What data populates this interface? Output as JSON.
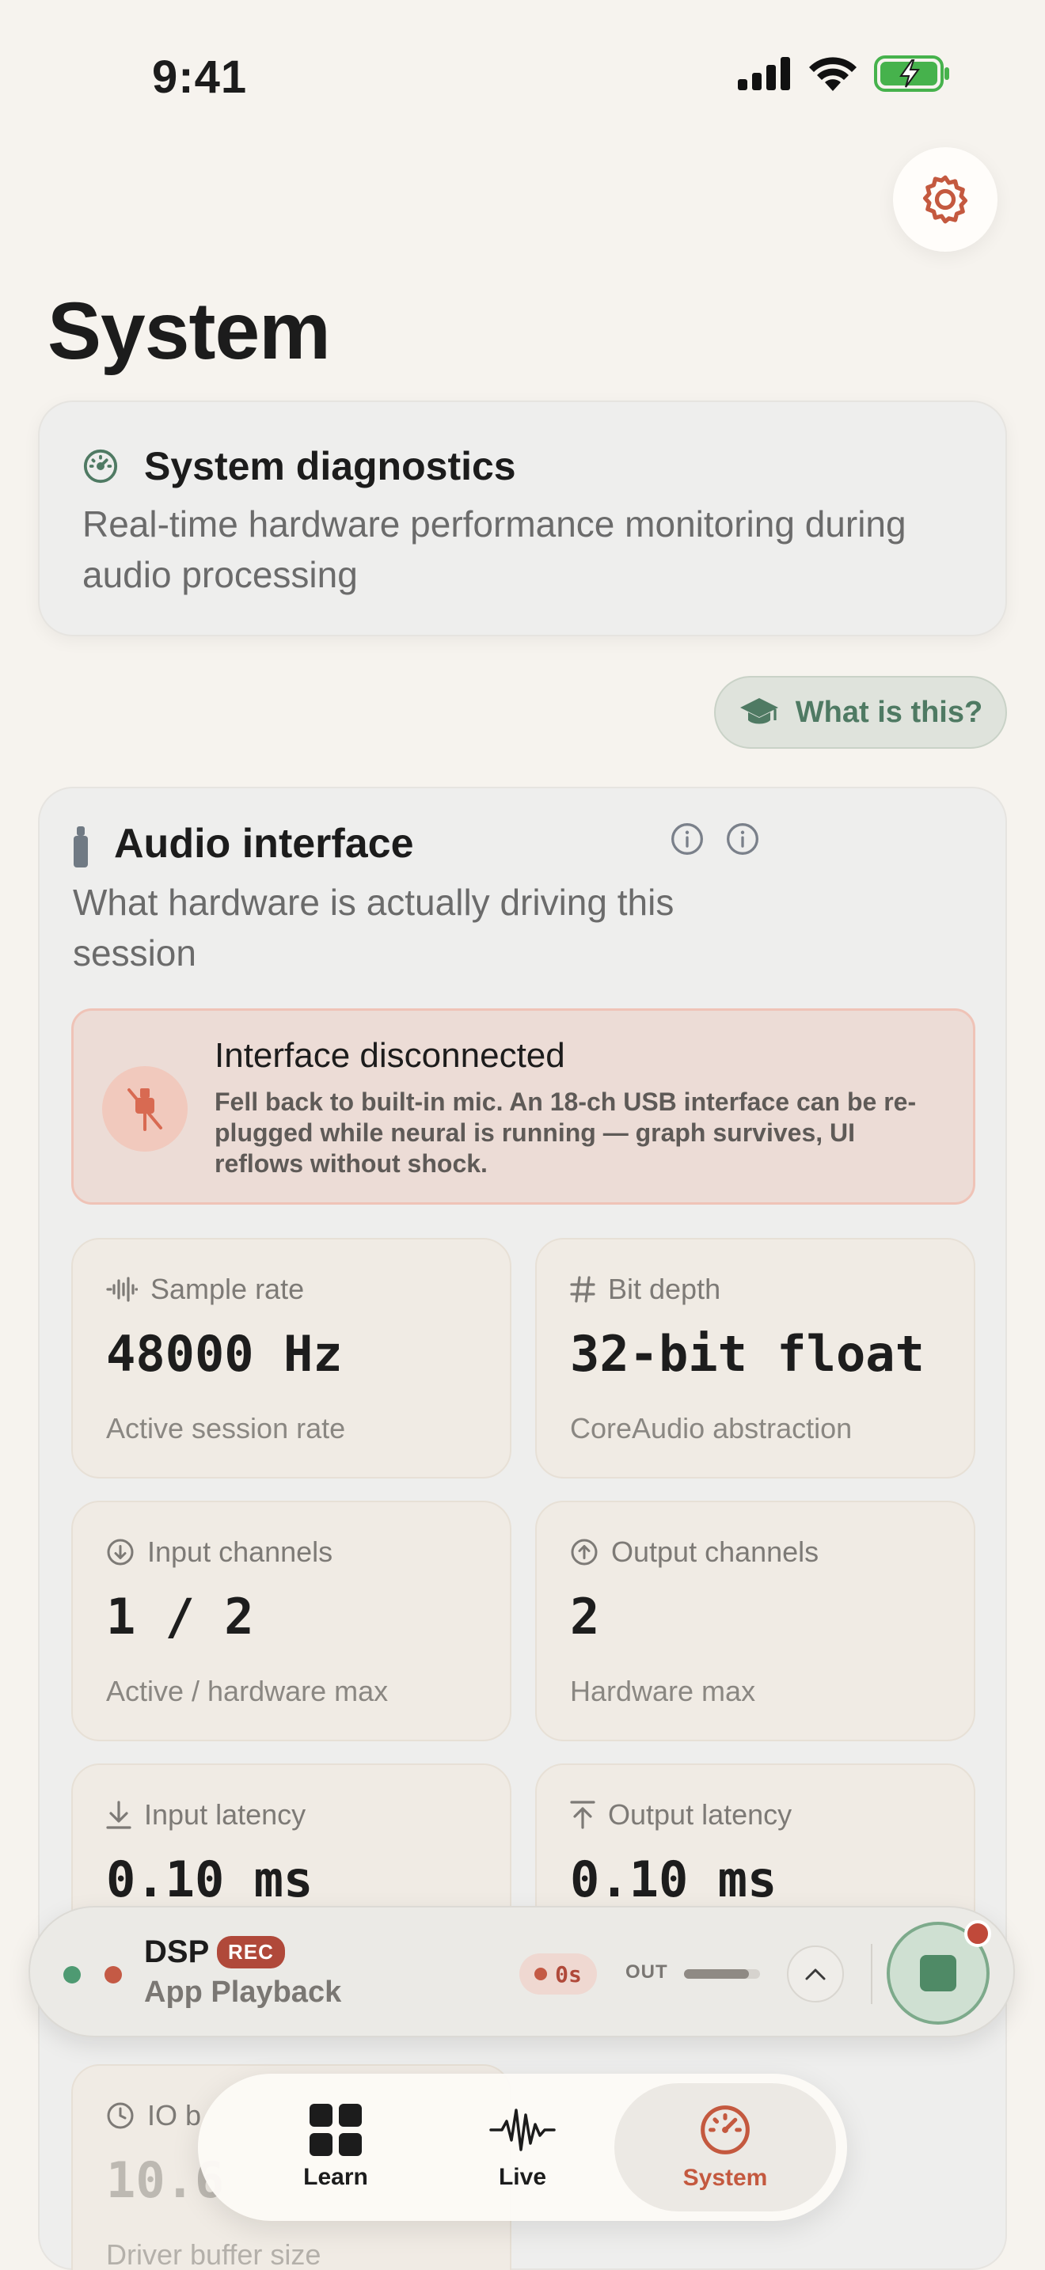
{
  "status_bar": {
    "time": "9:41"
  },
  "page": {
    "title": "System"
  },
  "diagnostics": {
    "title": "System diagnostics",
    "description": "Real-time hardware performance monitoring during audio processing"
  },
  "help_button": {
    "label": "What is this?"
  },
  "audio_interface": {
    "title": "Audio interface",
    "subtitle": "What hardware is actually driving this session",
    "alert": {
      "title": "Interface disconnected",
      "body": "Fell back to built-in mic. An 18-ch USB interface can be re-plugged while neural is running — graph survives, UI reflows without shock."
    },
    "metrics": [
      {
        "label": "Sample rate",
        "value": "48000 Hz",
        "sub": "Active session rate",
        "icon": "waveform-icon"
      },
      {
        "label": "Bit depth",
        "value": "32-bit float",
        "sub": "CoreAudio abstraction",
        "icon": "hash-icon"
      },
      {
        "label": "Input channels",
        "value": "1 / 2",
        "sub": "Active / hardware max",
        "icon": "arrow-down-circle-icon"
      },
      {
        "label": "Output channels",
        "value": "2",
        "sub": "Hardware max",
        "icon": "arrow-up-circle-icon"
      },
      {
        "label": "Input latency",
        "value": "0.10 ms",
        "sub": "",
        "icon": "arrow-down-bar-icon"
      },
      {
        "label": "Output latency",
        "value": "0.10 ms",
        "sub": "",
        "icon": "arrow-up-bar-icon"
      },
      {
        "label": "IO b",
        "value": "10.6",
        "sub": "Driver buffer size",
        "icon": "clock-icon"
      }
    ]
  },
  "playback": {
    "title": "DSP",
    "rec_badge": "REC",
    "source": "App Playback",
    "timer": "0s",
    "out_label": "OUT",
    "out_level": 0.85
  },
  "tabs": [
    {
      "label": "Learn"
    },
    {
      "label": "Live"
    },
    {
      "label": "System"
    }
  ],
  "colors": {
    "accent": "#c4593f",
    "success": "#4e9a72",
    "background": "#f6f3ee"
  }
}
